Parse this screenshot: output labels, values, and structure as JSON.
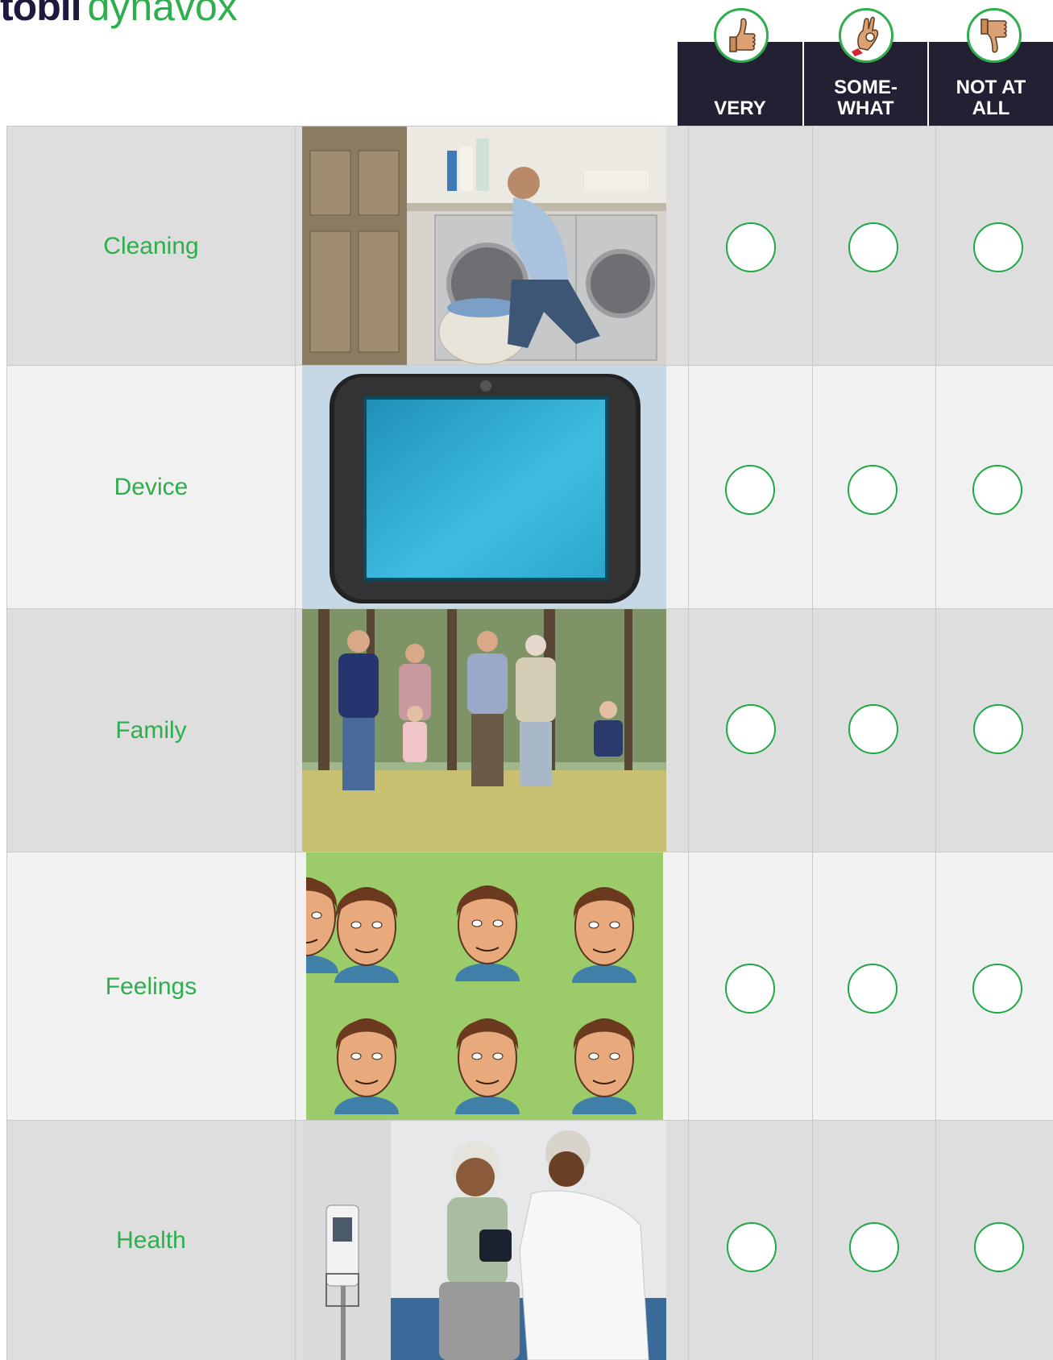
{
  "brand": {
    "part1": "tobii",
    "part2": "dynavox"
  },
  "columns": [
    {
      "line1": "VERY",
      "line2": "",
      "icon": "thumbs-up-icon"
    },
    {
      "line1": "SOME-",
      "line2": "WHAT",
      "icon": "ok-hand-icon"
    },
    {
      "line1": "NOT AT",
      "line2": "ALL",
      "icon": "thumbs-down-icon"
    }
  ],
  "rows": [
    {
      "label": "Cleaning",
      "image": "laundry-photo"
    },
    {
      "label": "Device",
      "image": "tablet-device-photo"
    },
    {
      "label": "Family",
      "image": "family-walk-photo"
    },
    {
      "label": "Feelings",
      "image": "facial-expressions-illustration"
    },
    {
      "label": "Health",
      "image": "doctor-visit-photo"
    }
  ],
  "colors": {
    "accent": "#2fae4e",
    "header_bg": "#232033",
    "row_dark": "#dedede",
    "row_light": "#f1f1f1"
  }
}
